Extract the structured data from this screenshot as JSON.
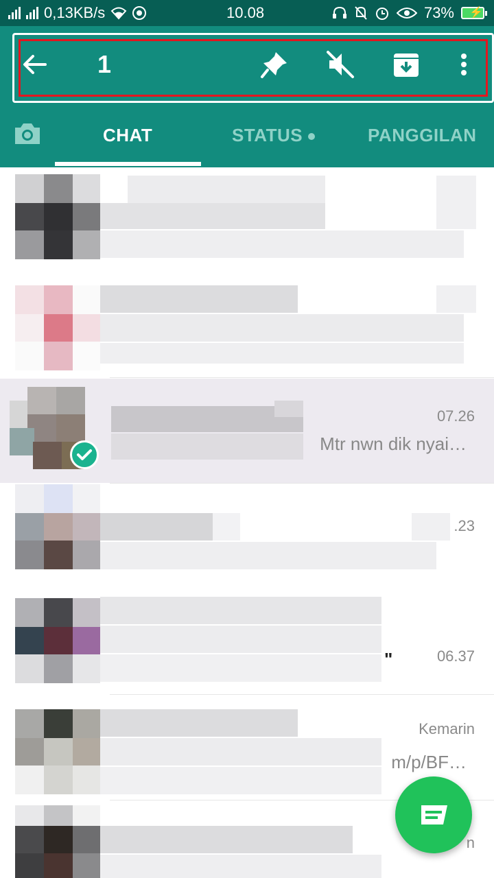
{
  "status_bar": {
    "net_speed": "0,13KB/s",
    "time": "10.08",
    "battery": "73%"
  },
  "action_bar": {
    "selected_count": "1"
  },
  "tabs": [
    {
      "label": "CHAT"
    },
    {
      "label": "STATUS"
    },
    {
      "label": "PANGGILAN"
    }
  ],
  "chats": [
    {
      "time": "07.26",
      "preview": "Mtr nwn dik nyai…"
    },
    {
      "time": ".23",
      "preview": ""
    },
    {
      "time": "06.37",
      "preview": "\""
    },
    {
      "time": "Kemarin",
      "preview": "m/p/BF…"
    },
    {
      "time": "n",
      "preview": ""
    }
  ],
  "colors": {
    "header": "#128c7e",
    "status_bar": "#075e54",
    "selected_row": "#edeaf0",
    "fab": "#20c25a",
    "highlight_box": "#e3161f"
  }
}
